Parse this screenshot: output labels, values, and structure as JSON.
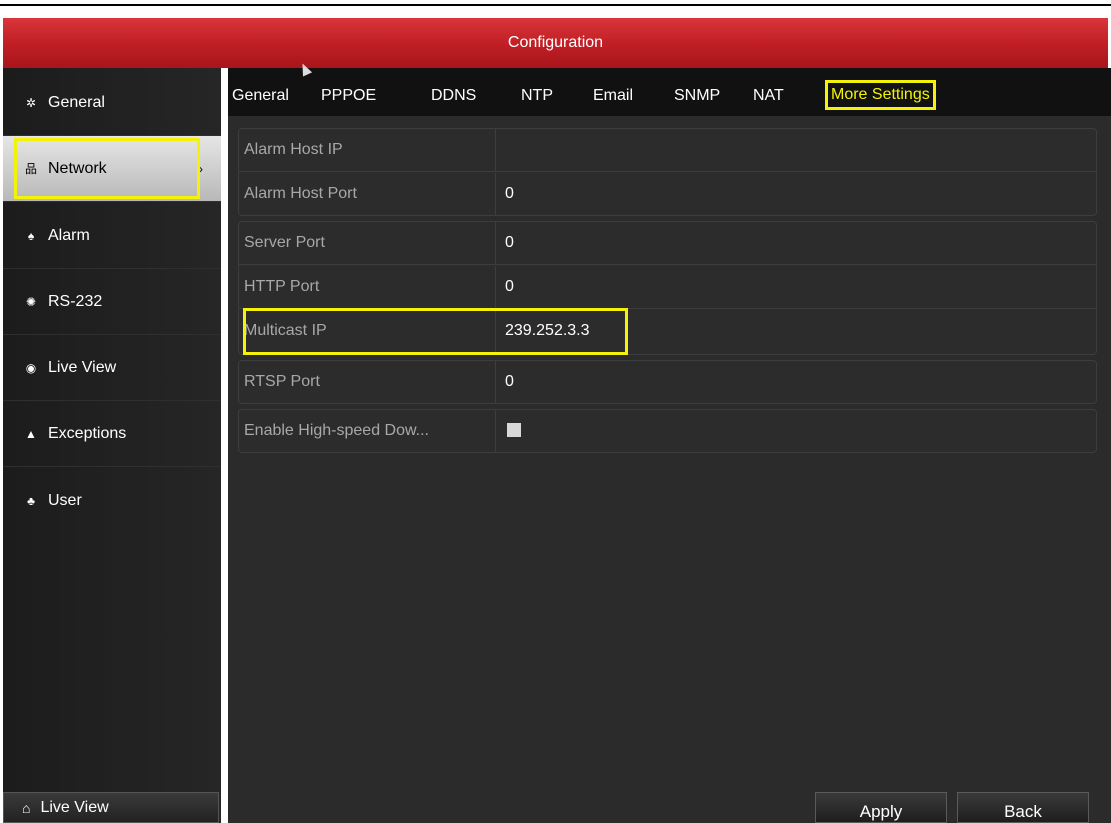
{
  "window": {
    "title": "Configuration"
  },
  "sidebar": {
    "items": [
      {
        "label": "General",
        "icon": "gear-icon"
      },
      {
        "label": "Network",
        "icon": "network-icon",
        "active": true
      },
      {
        "label": "Alarm",
        "icon": "alarm-icon"
      },
      {
        "label": "RS-232",
        "icon": "serial-port-icon"
      },
      {
        "label": "Live View",
        "icon": "eye-icon"
      },
      {
        "label": "Exceptions",
        "icon": "warning-icon"
      },
      {
        "label": "User",
        "icon": "users-icon"
      }
    ],
    "live_view_button": {
      "label": "Live View",
      "icon": "home-icon"
    }
  },
  "tabs": [
    {
      "label": "General"
    },
    {
      "label": "PPPOE"
    },
    {
      "label": "DDNS"
    },
    {
      "label": "NTP"
    },
    {
      "label": "Email"
    },
    {
      "label": "SNMP"
    },
    {
      "label": "NAT"
    },
    {
      "label": "More Settings",
      "selected": true
    }
  ],
  "settings": {
    "alarm_host_ip": {
      "label": "Alarm Host IP",
      "value": ""
    },
    "alarm_host_port": {
      "label": "Alarm Host Port",
      "value": "0"
    },
    "server_port": {
      "label": "Server Port",
      "value": "0"
    },
    "http_port": {
      "label": "HTTP Port",
      "value": "0"
    },
    "multicast_ip": {
      "label": "Multicast IP",
      "value": "239.252.3.3"
    },
    "rtsp_port": {
      "label": "RTSP Port",
      "value": "0"
    },
    "high_speed_download": {
      "label": "Enable High-speed Dow...",
      "checked": false
    }
  },
  "buttons": {
    "apply": "Apply",
    "back": "Back"
  },
  "colors": {
    "title_red": "#c12026",
    "highlight_yellow": "#f5f20a",
    "panel_dark": "#2b2b2b"
  }
}
